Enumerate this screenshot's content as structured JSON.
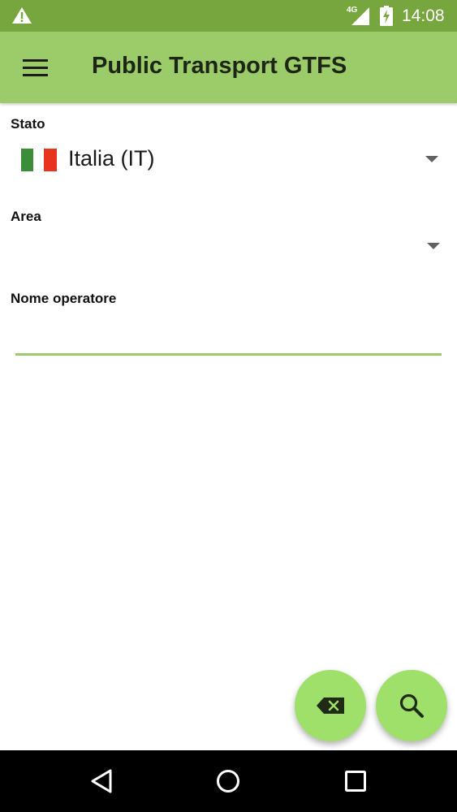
{
  "status_bar": {
    "network": "4G",
    "time": "14:08",
    "icons": [
      "warning-icon",
      "signal-icon",
      "battery-charging-icon"
    ]
  },
  "toolbar": {
    "title": "Public Transport GTFS",
    "menu_icon": "hamburger-menu-icon"
  },
  "form": {
    "country": {
      "label": "Stato",
      "selected": "Italia (IT)",
      "flag": [
        "#3c8d3a",
        "#ffffff",
        "#e8331f"
      ]
    },
    "area": {
      "label": "Area",
      "selected": ""
    },
    "operator": {
      "label": "Nome operatore",
      "value": "",
      "placeholder": ""
    }
  },
  "fabs": {
    "clear_icon": "backspace-clear-icon",
    "search_icon": "search-icon"
  },
  "nav_bar": {
    "icons": [
      "back-icon",
      "home-icon",
      "recents-icon"
    ]
  },
  "colors": {
    "status_bar": "#77a63f",
    "toolbar": "#9ccc6a",
    "fab": "#9fe06a",
    "accent": "#9ccc6a"
  }
}
